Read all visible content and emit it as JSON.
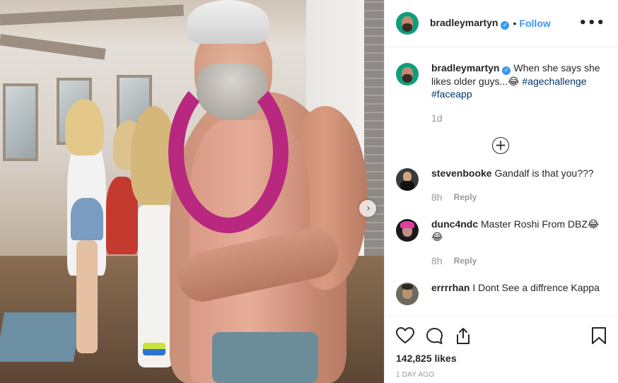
{
  "post": {
    "author": "bradleymartyn",
    "verified_mark": "✓",
    "separator": "•",
    "follow_label": "Follow",
    "more_label": "•••",
    "image_alt_icon": "photo",
    "next_icon": "chevron-right-icon",
    "next_glyph": "›"
  },
  "caption": {
    "user": "bradleymartyn",
    "text": "When she says she likes older guys...😂 ",
    "tags": [
      "#agechallenge",
      "#faceapp"
    ],
    "time": "1d"
  },
  "load_more_glyph": "+",
  "comments": [
    {
      "user": "stevenbooke",
      "text": "Gandalf is that you???",
      "time": "8h",
      "reply": "Reply"
    },
    {
      "user": "dunc4ndc",
      "text": "Master Roshi From DBZ😂😂",
      "time": "8h",
      "reply": "Reply"
    },
    {
      "user": "errrrhan",
      "text": "I Dont See a diffrence Kappa"
    }
  ],
  "actions": {
    "likes": "142,825 likes",
    "posted": "1 DAY AGO"
  },
  "colors": {
    "link": "#3897f0",
    "hashtag": "#003569",
    "text": "#262626",
    "muted": "#999999"
  }
}
